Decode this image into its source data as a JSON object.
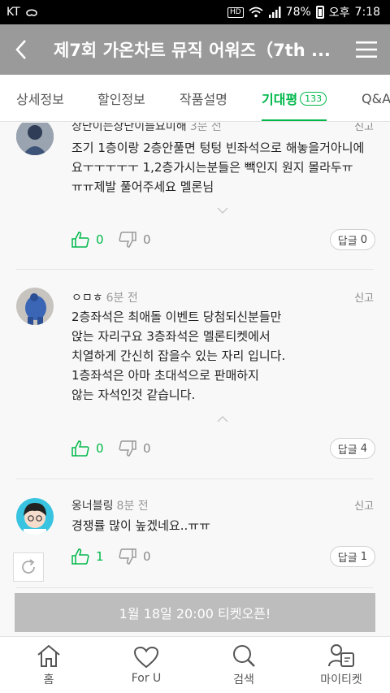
{
  "statusbar": {
    "carrier": "KT",
    "hd": "HD",
    "battery": "78%",
    "ampm": "오후",
    "time": "7:18"
  },
  "header": {
    "title": "제7회 가온차트 뮤직 어워즈（7th ..."
  },
  "tabs": [
    {
      "label": "상세정보"
    },
    {
      "label": "할인정보"
    },
    {
      "label": "작품설명"
    },
    {
      "label": "기대평",
      "badge": "133"
    },
    {
      "label": "Q&A"
    }
  ],
  "comments": [
    {
      "author": "상단이는상단이를요미해",
      "time": "3분 전",
      "report": "신고",
      "text": "조기 1층이랑 2층안풀면 텅텅 빈좌석으로 해놓을거아니에\n요ㅜㅜㅜㅜㅜ 1,2층가시는분들은 빽인지 원지 몰라두ㅠ\nㅠㅠ제발 풀어주세요 멜론님",
      "likes": "0",
      "dislikes": "0",
      "reply_label": "답글",
      "reply_count": "0"
    },
    {
      "author": "ㅇㅁㅎ",
      "time": "6분 전",
      "report": "신고",
      "text": "2층좌석은 최애돌 이벤트 당첨되신분들만\n앉는 자리구요 3층좌석은 멜론티켓에서\n치열하게 간신히 잡을수 있는 자리 입니다.\n1층좌석은 아마 초대석으로 판매하지\n않는 자석인것 같습니다.",
      "likes": "0",
      "dislikes": "0",
      "reply_label": "답글",
      "reply_count": "4"
    },
    {
      "author": "옹너블링",
      "time": "8분 전",
      "report": "신고",
      "text": "경쟁률 많이 높겠네요..ㅠㅠ",
      "likes": "1",
      "dislikes": "0",
      "reply_label": "답글",
      "reply_count": "1"
    }
  ],
  "ticket_open": "1월 18일 20:00 티켓오픈!",
  "nav": [
    {
      "label": "홈",
      "icon": "home-icon"
    },
    {
      "label": "For U",
      "icon": "heart-icon"
    },
    {
      "label": "검색",
      "icon": "search-icon"
    },
    {
      "label": "마이티켓",
      "icon": "my-ticket-icon"
    }
  ],
  "colors": {
    "accent": "#00b84a",
    "header_bg": "#9a9a9a",
    "ticket_bar": "#bdbdbd"
  }
}
